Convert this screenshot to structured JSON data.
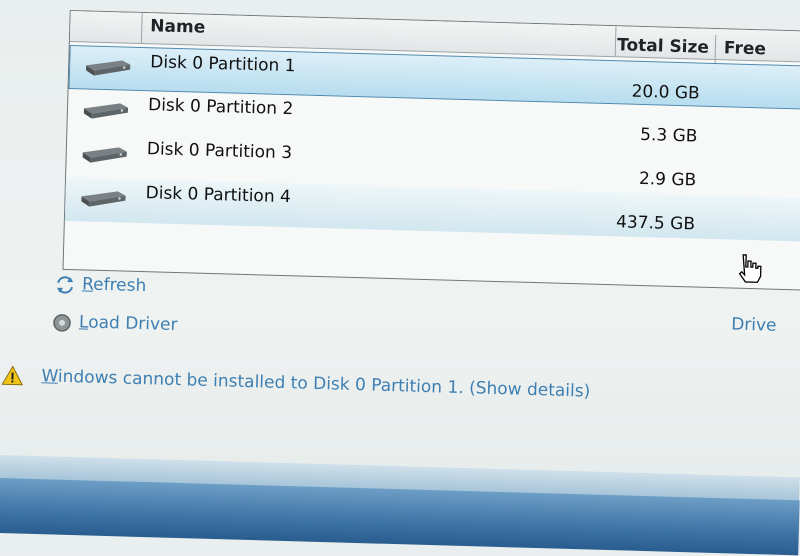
{
  "table": {
    "headers": {
      "name": "Name",
      "total_size": "Total Size",
      "free": "Free"
    },
    "rows": [
      {
        "name": "Disk 0 Partition 1",
        "size": "20.0 GB",
        "free": ""
      },
      {
        "name": "Disk 0 Partition 2",
        "size": "5.3 GB",
        "free": ""
      },
      {
        "name": "Disk 0 Partition 3",
        "size": "2.9 GB",
        "free": ""
      },
      {
        "name": "Disk 0 Partition 4",
        "size": "437.5 GB",
        "free": ""
      }
    ]
  },
  "actions": {
    "refresh": {
      "underline": "R",
      "rest": "efresh"
    },
    "load_driver": {
      "underline": "L",
      "rest": "oad Driver"
    },
    "drive_options": "Drive"
  },
  "warning": {
    "underline": "W",
    "rest": "indows cannot be installed to Disk 0 Partition 1.",
    "details": "(Show details)"
  },
  "icons": [
    "disk-icon",
    "refresh-icon",
    "load-driver-icon",
    "warning-icon",
    "hand-cursor-icon"
  ]
}
